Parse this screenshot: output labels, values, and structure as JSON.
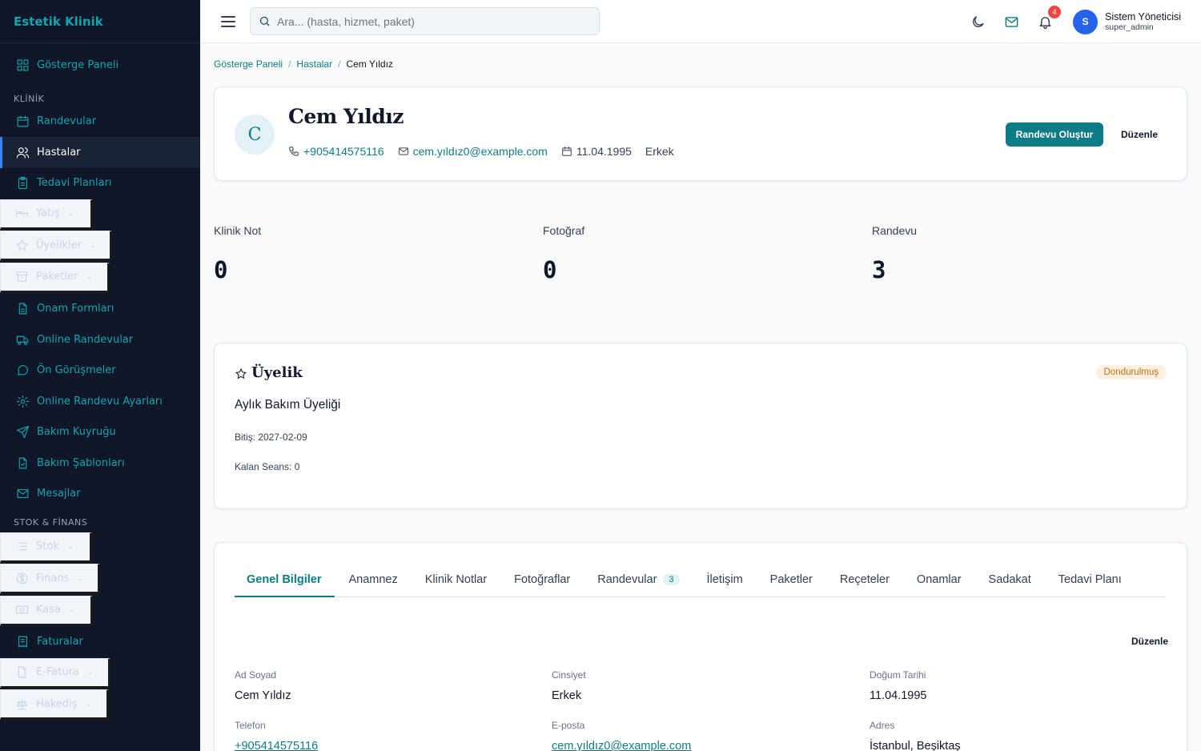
{
  "sidebar": {
    "brand": "Estetik Klinik",
    "items_top": [
      {
        "label": "Gösterge Paneli",
        "icon": "grid-icon"
      }
    ],
    "section_klinik": "KLİNİK",
    "klinik_items": [
      {
        "label": "Randevular",
        "icon": "calendar-icon"
      },
      {
        "label": "Hastalar",
        "icon": "users-icon",
        "active": true
      },
      {
        "label": "Tedavi Planları",
        "icon": "clipboard-icon"
      }
    ],
    "collapsed_a": [
      {
        "label": "Yatış",
        "icon": "bed-icon"
      },
      {
        "label": "Üyelikler",
        "icon": "star-icon"
      },
      {
        "label": "Paketler",
        "icon": "archive-icon"
      }
    ],
    "klinik_items_2": [
      {
        "label": "Onam Formları",
        "icon": "file-icon"
      },
      {
        "label": "Online Randevular",
        "icon": "truck-icon"
      },
      {
        "label": "Ön Görüşmeler",
        "icon": "chat-icon"
      },
      {
        "label": "Online Randevu Ayarları",
        "icon": "gear-icon"
      },
      {
        "label": "Bakım Kuyruğu",
        "icon": "send-icon"
      },
      {
        "label": "Bakım Şablonları",
        "icon": "file-check-icon"
      },
      {
        "label": "Mesajlar",
        "icon": "mail-icon"
      }
    ],
    "section_stok": "STOK & FİNANS",
    "collapsed_b": [
      {
        "label": "Stok",
        "icon": "list-icon"
      },
      {
        "label": "Finans",
        "icon": "dollar-icon"
      },
      {
        "label": "Kasa",
        "icon": "cash-icon"
      }
    ],
    "faturalar": {
      "label": "Faturalar",
      "icon": "receipt-icon"
    },
    "collapsed_c": [
      {
        "label": "E-Fatura",
        "icon": "file-icon"
      },
      {
        "label": "Hakediş",
        "icon": "scale-icon"
      }
    ]
  },
  "topbar": {
    "search_placeholder": "Ara... (hasta, hizmet, paket)",
    "notification_count": "4",
    "avatar_letter": "S",
    "user_name": "Sistem Yöneticisi",
    "user_role": "super_admin"
  },
  "breadcrumb": {
    "home": "Gösterge Paneli",
    "section": "Hastalar",
    "current": "Cem Yıldız"
  },
  "patient": {
    "initial": "C",
    "name": "Cem Yıldız",
    "phone": "+905414575116",
    "email": "cem.yıldız0@example.com",
    "birth": "11.04.1995",
    "gender": "Erkek",
    "btn_appointment": "Randevu Oluştur",
    "btn_edit": "Düzenle"
  },
  "stats": [
    {
      "label": "Klinik Not",
      "value": "0"
    },
    {
      "label": "Fotoğraf",
      "value": "0"
    },
    {
      "label": "Randevu",
      "value": "3"
    }
  ],
  "membership": {
    "title": "Üyelik",
    "status": "Dondurulmuş",
    "plan": "Aylık Bakım Üyeliği",
    "end": "Bitiş: 2027-02-09",
    "remaining": "Kalan Seans: 0"
  },
  "tabs": [
    {
      "label": "Genel Bilgiler",
      "active": true
    },
    {
      "label": "Anamnez"
    },
    {
      "label": "Klinik Notlar"
    },
    {
      "label": "Fotoğraflar"
    },
    {
      "label": "Randevular",
      "count": "3"
    },
    {
      "label": "İletişim"
    },
    {
      "label": "Paketler"
    },
    {
      "label": "Reçeteler"
    },
    {
      "label": "Onamlar"
    },
    {
      "label": "Sadakat"
    },
    {
      "label": "Tedavi Planı"
    }
  ],
  "general": {
    "edit_label": "Düzenle",
    "fields": [
      {
        "label": "Ad Soyad",
        "value": "Cem Yıldız"
      },
      {
        "label": "Cinsiyet",
        "value": "Erkek"
      },
      {
        "label": "Doğum Tarihi",
        "value": "11.04.1995"
      },
      {
        "label": "Telefon",
        "value": "+905414575116",
        "link": true
      },
      {
        "label": "E-posta",
        "value": "cem.yıldız0@example.com",
        "link": true
      },
      {
        "label": "Adres",
        "value": "İstanbul, Beşiktaş"
      }
    ]
  },
  "colors": {
    "sidebar_bg": "#0f1729",
    "accent": "#0e7c86",
    "active_border": "#3b82f6",
    "badge_red": "#ef4444",
    "status_frozen": "#c2710c"
  }
}
